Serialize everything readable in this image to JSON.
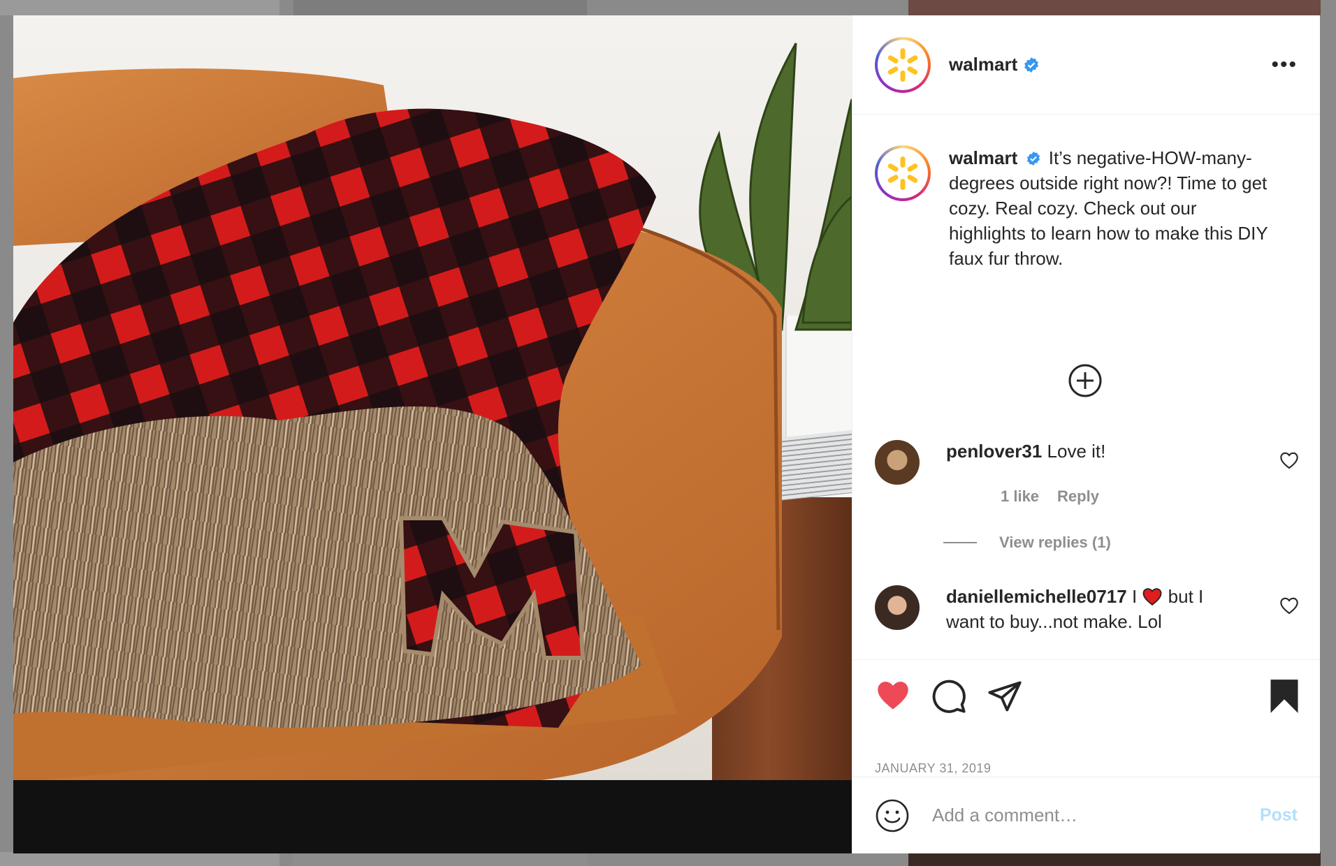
{
  "post": {
    "author": "walmart",
    "verified": true,
    "caption": "It’s negative-HOW-many-degrees outside right now?! Time to get cozy. Real cozy. Check out our highlights to learn how to make this DIY faux fur throw.",
    "date": "JANUARY 31, 2019",
    "liked": true,
    "saved": true
  },
  "header": {
    "more_label": "•••"
  },
  "comments": [
    {
      "user": "penlover31",
      "text": "Love it!",
      "likes_label": "1 like",
      "reply_label": "Reply",
      "view_replies_label": "View replies (1)"
    },
    {
      "user": "daniellemichelle0717",
      "text_before": "I",
      "text_after": "but I want to buy...not make. Lol"
    }
  ],
  "add_comment": {
    "placeholder": "Add a comment…",
    "post_label": "Post"
  },
  "colors": {
    "accent_blue": "#b2dffc",
    "verified_blue": "#3897f0",
    "like_red": "#ed4956",
    "walmart_yellow": "#ffc220"
  },
  "icons": {
    "more": "more-dots-icon",
    "load_more": "plus-circle-icon",
    "like": "heart-icon",
    "comment": "comment-bubble-icon",
    "share": "paper-plane-icon",
    "save": "bookmark-icon",
    "emoji": "emoji-icon"
  }
}
